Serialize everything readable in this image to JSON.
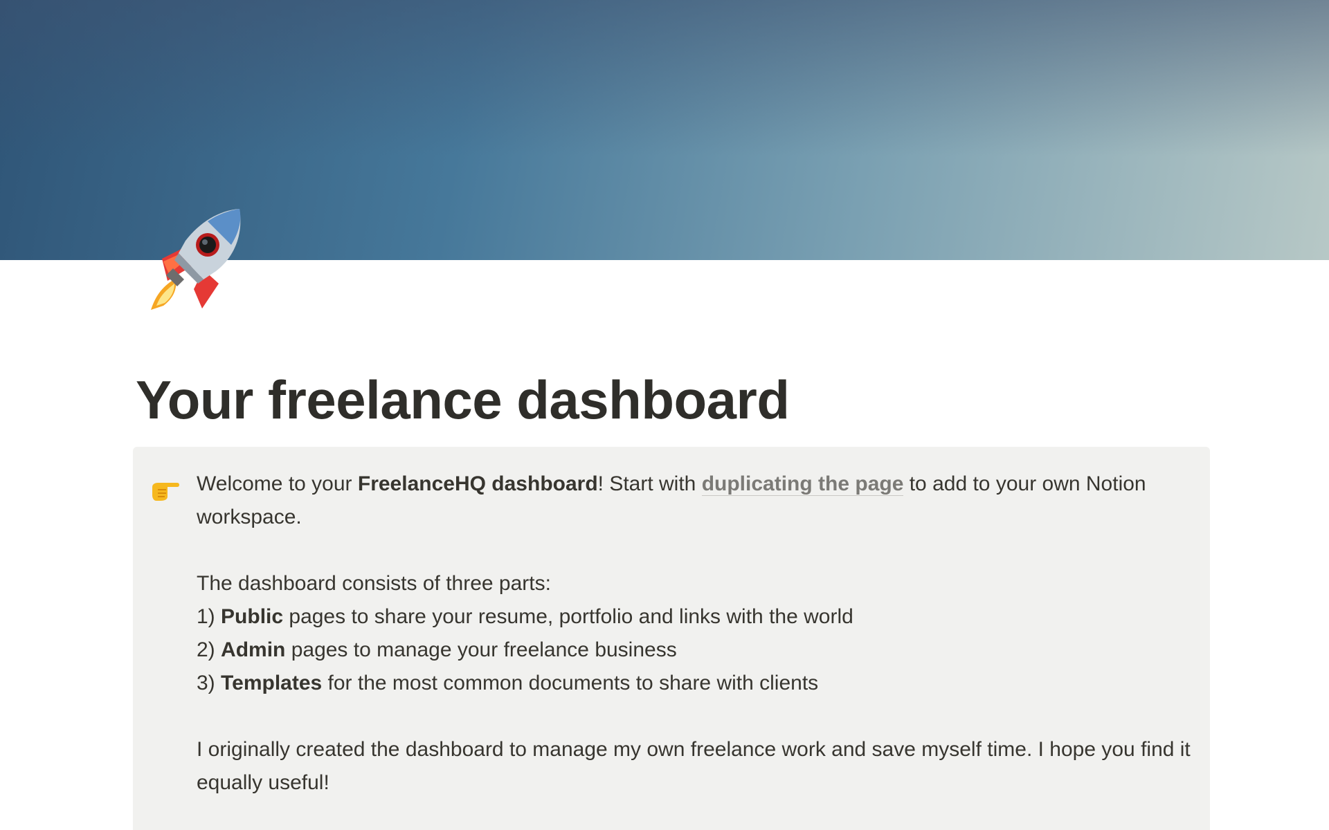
{
  "page": {
    "title": "Your freelance dashboard",
    "icon": "rocket-icon",
    "cover_colors": [
      "#2f5577",
      "#46789a",
      "#7aa0b2",
      "#b7c8c6"
    ]
  },
  "callout": {
    "icon": "backhand-index-pointing-right-icon",
    "background": "#f1f1ef",
    "intro": {
      "text_before": "Welcome to your ",
      "bold": "FreelanceHQ dashboard",
      "text_after_bold": "! Start with ",
      "link_label": "duplicating the page",
      "text_after_link": " to add to your own Notion workspace."
    },
    "parts_heading": "The dashboard consists of three parts:",
    "parts": [
      {
        "number": "1)",
        "bold": "Public",
        "rest": " pages to share your resume, portfolio and links with the world"
      },
      {
        "number": "2)",
        "bold": "Admin",
        "rest": " pages to manage your freelance business"
      },
      {
        "number": "3)",
        "bold": "Templates",
        "rest": " for the most common documents to share with clients"
      }
    ],
    "closing": "I originally created the dashboard to manage my own freelance work and save myself time. I hope you find it equally useful!"
  }
}
